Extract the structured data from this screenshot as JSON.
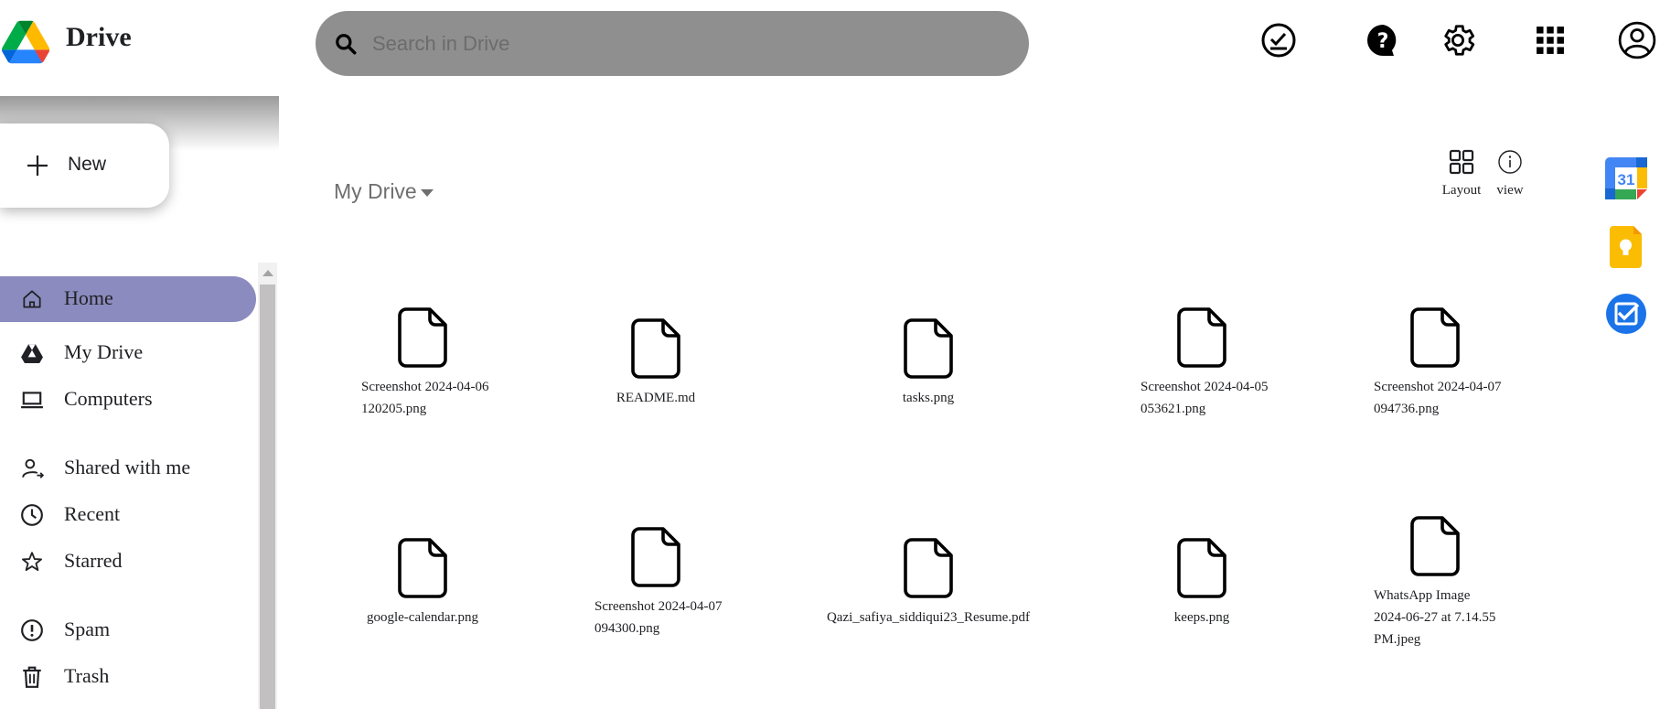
{
  "header": {
    "app_title": "Drive",
    "search_placeholder": "Search in Drive",
    "icons": [
      "ready-for-offline-icon",
      "help-icon",
      "settings-icon",
      "apps-grid-icon",
      "account-icon"
    ]
  },
  "sidebar": {
    "new_label": "New",
    "items": [
      {
        "label": "Home",
        "icon": "home-icon",
        "active": true
      },
      {
        "label": "My Drive",
        "icon": "drive-icon"
      },
      {
        "label": "Computers",
        "icon": "laptop-icon"
      },
      {
        "label": "Shared with me",
        "icon": "shared-person-icon"
      },
      {
        "label": "Recent",
        "icon": "clock-icon"
      },
      {
        "label": "Starred",
        "icon": "star-icon"
      },
      {
        "label": "Spam",
        "icon": "spam-icon"
      },
      {
        "label": "Trash",
        "icon": "trash-icon"
      }
    ]
  },
  "main": {
    "title": "My Drive",
    "toolbar": {
      "layout_label": "Layout",
      "view_label": "view"
    },
    "files": [
      {
        "name": "Screenshot 2024-04-06 120205.png"
      },
      {
        "name": "README.md"
      },
      {
        "name": "tasks.png"
      },
      {
        "name": "Screenshot 2024-04-05 053621.png"
      },
      {
        "name": "Screenshot 2024-04-07 094736.png"
      },
      {
        "name": "google-calendar.png"
      },
      {
        "name": "Screenshot 2024-04-07 094300.png"
      },
      {
        "name": "Qazi_safiya_siddiqui23_Resume.pdf"
      },
      {
        "name": "keeps.png"
      },
      {
        "name": "WhatsApp Image 2024-06-27 at 7.14.55 PM.jpeg"
      }
    ]
  },
  "rail": {
    "calendar_day": "31",
    "apps": [
      "calendar-app-icon",
      "keep-app-icon",
      "tasks-app-icon"
    ]
  },
  "colors": {
    "search_bg": "#8f8f8f",
    "active_nav": "#8b8bbf",
    "scroll_thumb": "#c2c0c0"
  }
}
